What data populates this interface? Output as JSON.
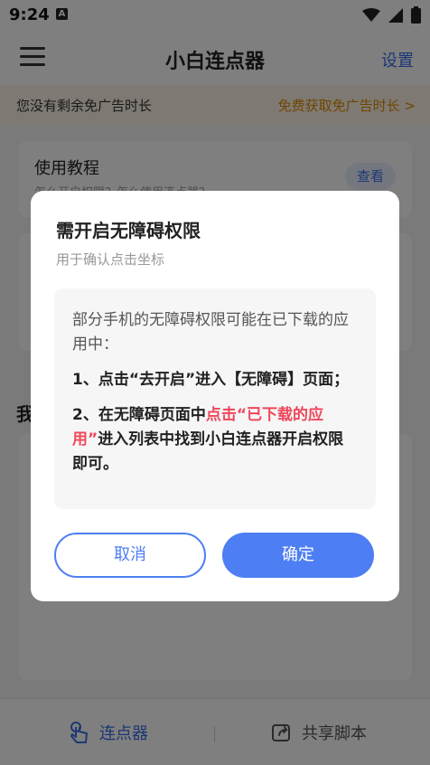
{
  "status_bar": {
    "time": "9:24",
    "a_icon": "A"
  },
  "app_bar": {
    "title": "小白连点器",
    "settings": "设置"
  },
  "ad_banner": {
    "text": "您没有剩余免广告时长",
    "link": "免费获取免广告时长 >"
  },
  "tutorial": {
    "title": "使用教程",
    "subtitle": "怎么开启权限？怎么使用连点器？",
    "view": "查看"
  },
  "section_label": "我",
  "bottom_nav": {
    "clicker": "连点器",
    "share": "共享脚本"
  },
  "dialog": {
    "title": "需开启无障碍权限",
    "subtitle": "用于确认点击坐标",
    "intro": "部分手机的无障碍权限可能在已下载的应用中：",
    "step1": "1、点击“去开启”进入【无障碍】页面；",
    "step2_prefix": "2、在无障碍页面中",
    "step2_highlight": "点击“已下载的应用”",
    "step2_suffix": "进入列表中找到小白连点器开启权限即可。",
    "cancel": "取消",
    "confirm": "确定"
  },
  "colors": {
    "accent": "#4d7ef3",
    "highlight": "#f0475a",
    "ad_link": "#e08a00"
  }
}
